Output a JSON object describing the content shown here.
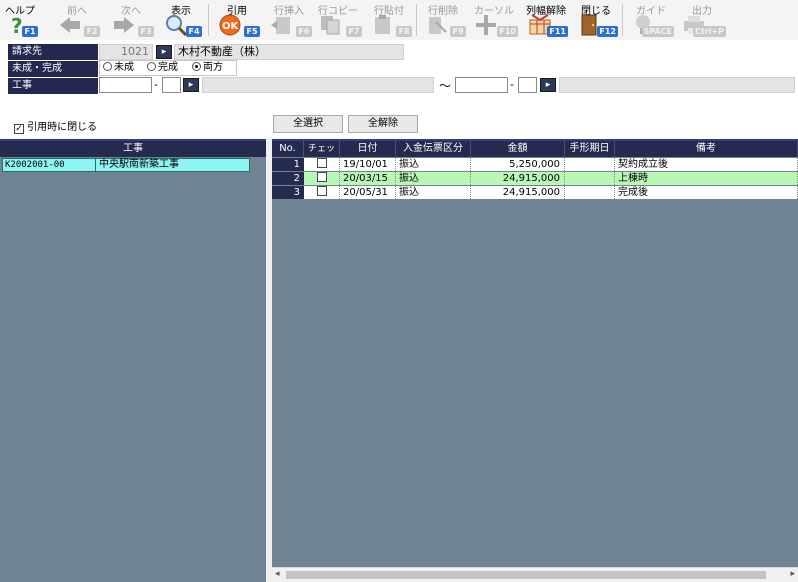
{
  "toolbar": {
    "help": {
      "label": "ヘルプ",
      "fkey": "F1"
    },
    "prev": {
      "label": "前へ",
      "fkey": "F2"
    },
    "next": {
      "label": "次へ",
      "fkey": "F3"
    },
    "display": {
      "label": "表示",
      "fkey": "F4"
    },
    "quote": {
      "label": "引用",
      "fkey": "F5"
    },
    "row_insert": {
      "label": "行挿入",
      "fkey": "F6"
    },
    "row_copy": {
      "label": "行コピー",
      "fkey": "F7"
    },
    "row_paste": {
      "label": "行貼付",
      "fkey": "F8"
    },
    "row_delete": {
      "label": "行削除",
      "fkey": "F9"
    },
    "cursor": {
      "label": "カーソル",
      "fkey": "F10"
    },
    "col_width_reset": {
      "label": "列幅解除",
      "fkey": "F11"
    },
    "close": {
      "label": "閉じる",
      "fkey": "F12"
    },
    "guide": {
      "label": "ガイド",
      "fkey": "SPACE"
    },
    "output": {
      "label": "出力",
      "fkey": "Ctrl+P"
    }
  },
  "form": {
    "billing_label": "請求先",
    "billing_code": "1021",
    "billing_name": "木村不動産（株）",
    "status_label": "未成・完成",
    "radio_incomplete": "未成",
    "radio_complete": "完成",
    "radio_both": "両方",
    "radio_selected": "both",
    "work_label": "工事",
    "range_sep": "〜",
    "dash": "-",
    "close_on_quote": "引用時に閉じる"
  },
  "buttons": {
    "select_all": "全選択",
    "deselect_all": "全解除"
  },
  "left_panel": {
    "header": "工事",
    "rows": [
      {
        "code": "K2002001-00",
        "name": "中央駅南新築工事"
      }
    ]
  },
  "grid": {
    "headers": {
      "no": "No.",
      "check": "チェック",
      "date": "日付",
      "slip_type": "入金伝票区分",
      "amount": "金額",
      "note_due": "手形期日",
      "remarks": "備考"
    },
    "rows": [
      {
        "no": "1",
        "date": "19/10/01",
        "slip_type": "振込",
        "amount": "5,250,000",
        "note_due": "",
        "remarks": "契約成立後"
      },
      {
        "no": "2",
        "date": "20/03/15",
        "slip_type": "振込",
        "amount": "24,915,000",
        "note_due": "",
        "remarks": "上棟時"
      },
      {
        "no": "3",
        "date": "20/05/31",
        "slip_type": "振込",
        "amount": "24,915,000",
        "note_due": "",
        "remarks": "完成後"
      }
    ]
  },
  "colors": {
    "header_navy": "#252a4f",
    "panel_bg": "#6f8393",
    "selected_row": "#8ff5f2",
    "highlight_row": "#b8f7b4",
    "fkey_blue": "#2b6fd6"
  }
}
